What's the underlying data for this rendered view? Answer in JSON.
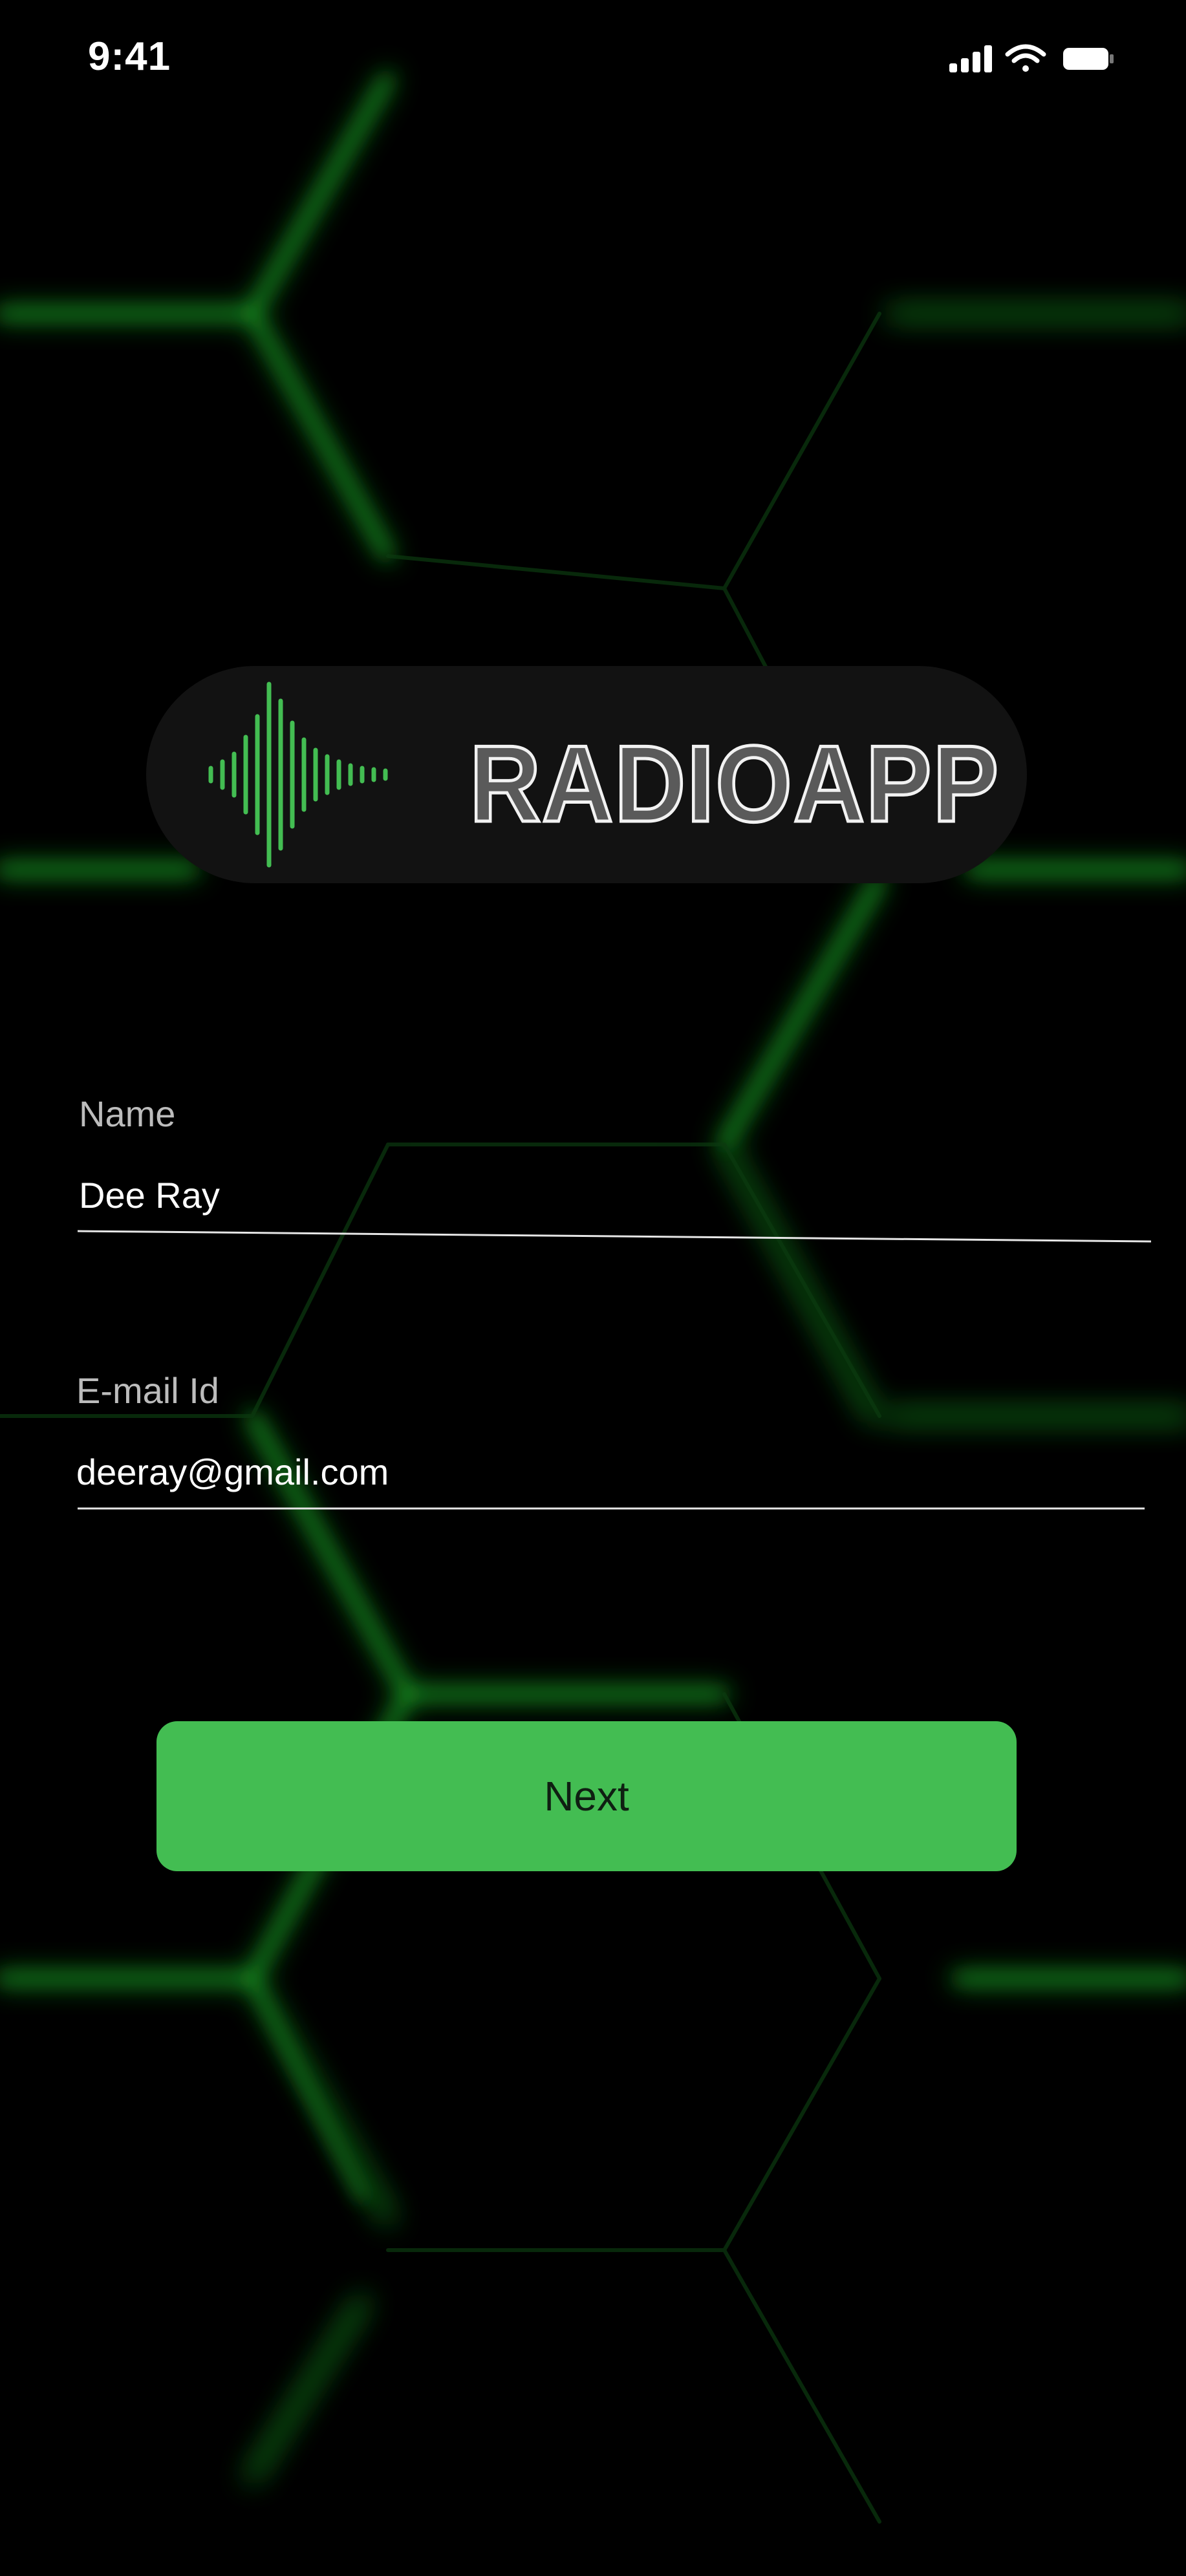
{
  "status_bar": {
    "time": "9:41",
    "icons": [
      "cellular-signal-icon",
      "wifi-icon",
      "battery-icon"
    ]
  },
  "logo": {
    "text": "RADIOAPP",
    "icon": "sound-wave-icon"
  },
  "form": {
    "name_label": "Name",
    "name_value": "Dee Ray",
    "email_label": "E-mail Id",
    "email_value": "deeray@gmail.com"
  },
  "actions": {
    "next_label": "Next"
  },
  "colors": {
    "background": "#000000",
    "accent_green": "#43bd52",
    "glow_green": "#27e02d",
    "logo_pill": "#121212",
    "label_gray": "#bcbcbc",
    "text_white": "#ffffff"
  }
}
